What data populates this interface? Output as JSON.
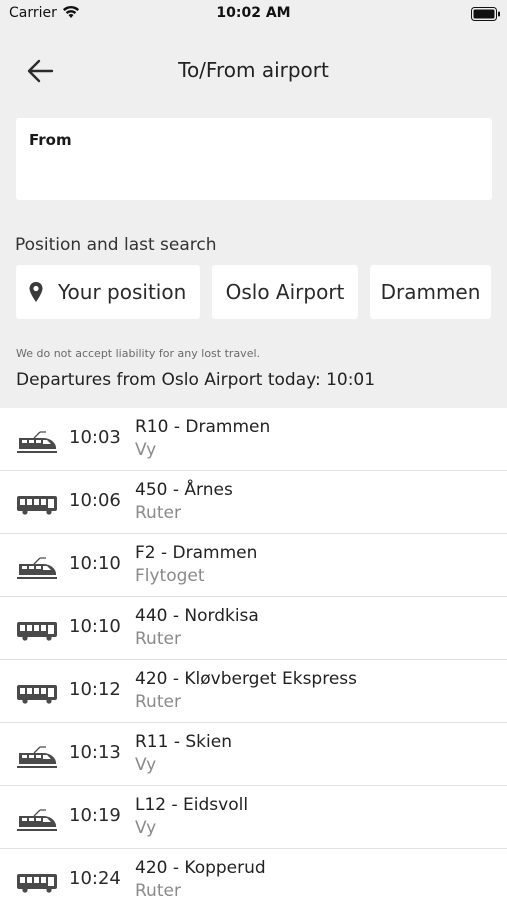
{
  "status_bar": {
    "carrier": "Carrier",
    "time": "10:02 AM"
  },
  "header": {
    "title": "To/From airport",
    "back_icon": "arrow-left-icon"
  },
  "from_field": {
    "label": "From"
  },
  "position_section": {
    "heading": "Position and last search",
    "chips": [
      {
        "label": "Your position",
        "icon": "location-pin-icon"
      },
      {
        "label": "Oslo Airport"
      },
      {
        "label": "Drammen"
      }
    ]
  },
  "disclaimer": "We do not accept liability for any lost travel.",
  "departures_heading": "Departures from Oslo Airport today: 10:01",
  "departures": [
    {
      "type": "train",
      "time": "10:03",
      "route": "R10 - Drammen",
      "operator": "Vy"
    },
    {
      "type": "bus",
      "time": "10:06",
      "route": "450 - Årnes",
      "operator": "Ruter"
    },
    {
      "type": "train",
      "time": "10:10",
      "route": "F2 - Drammen",
      "operator": "Flytoget"
    },
    {
      "type": "bus",
      "time": "10:10",
      "route": "440 - Nordkisa",
      "operator": "Ruter"
    },
    {
      "type": "bus",
      "time": "10:12",
      "route": "420 - Kløvberget Ekspress",
      "operator": "Ruter"
    },
    {
      "type": "train",
      "time": "10:13",
      "route": "R11 - Skien",
      "operator": "Vy"
    },
    {
      "type": "train",
      "time": "10:19",
      "route": "L12 - Eidsvoll",
      "operator": "Vy"
    },
    {
      "type": "bus",
      "time": "10:24",
      "route": "420 - Kopperud",
      "operator": "Ruter"
    }
  ],
  "colors": {
    "background_top": "#efeff0",
    "text": "#222222",
    "muted": "#8a8a8a"
  }
}
